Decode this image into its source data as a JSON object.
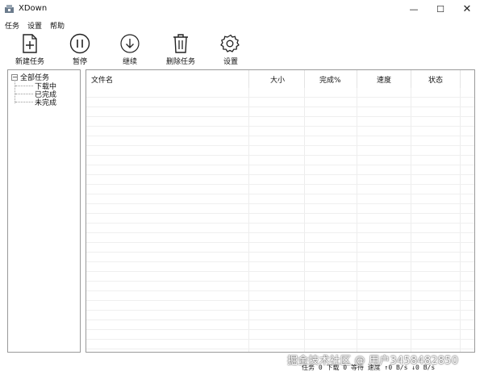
{
  "window": {
    "title": "XDown",
    "minimize_glyph": "—",
    "maximize_glyph": "☐",
    "close_glyph": "✕"
  },
  "menu": [
    "任务",
    "设置",
    "帮助"
  ],
  "toolbar": [
    {
      "label": "新建任务",
      "icon": "new-file-icon"
    },
    {
      "label": "暂停",
      "icon": "pause-icon"
    },
    {
      "label": "继续",
      "icon": "download-icon"
    },
    {
      "label": "删除任务",
      "icon": "trash-icon"
    },
    {
      "label": "设置",
      "icon": "gear-icon"
    }
  ],
  "tree": {
    "root": "全部任务",
    "expander": "−",
    "children": [
      "下载中",
      "已完成",
      "未完成"
    ]
  },
  "columns": [
    "文件名",
    "大小",
    "完成%",
    "速度",
    "状态"
  ],
  "status": {
    "tasks": "任务 0 下载  0 等待  速度 ↑0 B/s ↓0 B/s"
  },
  "watermark": "掘金技术社区 @ 用户3458482850"
}
